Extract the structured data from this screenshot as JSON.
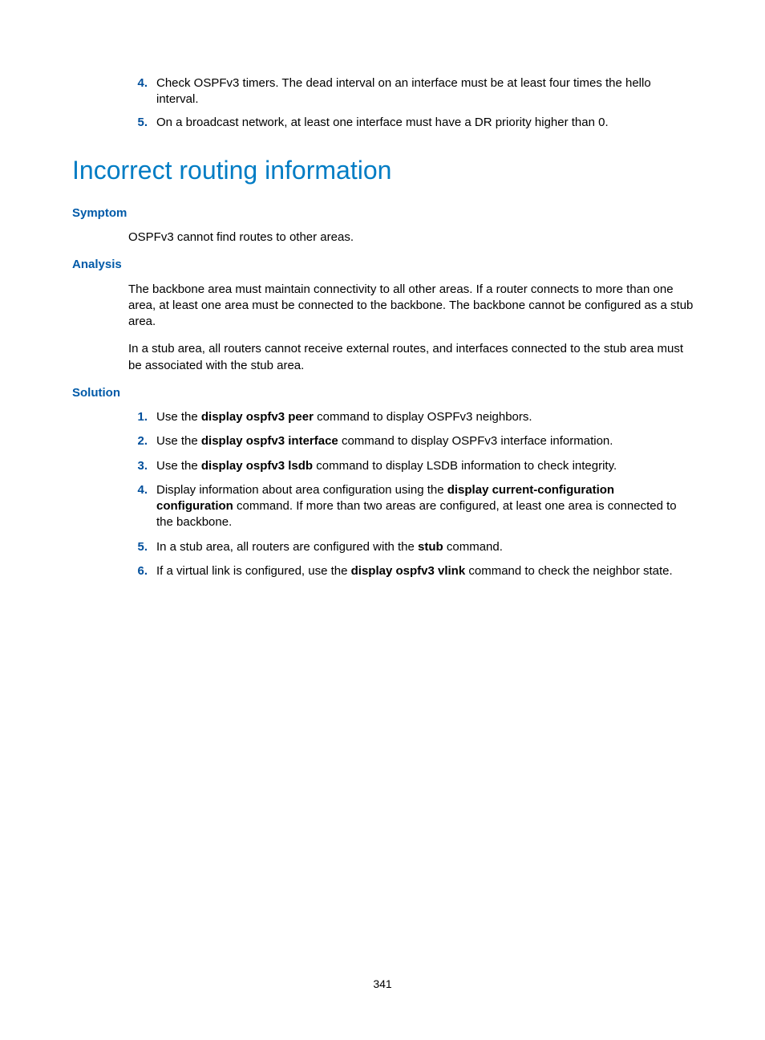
{
  "topList": {
    "item4": {
      "num": "4.",
      "text": "Check OSPFv3 timers. The dead interval on an interface must be at least four times the hello interval."
    },
    "item5": {
      "num": "5.",
      "text": "On a broadcast network, at least one interface must have a DR priority higher than 0."
    }
  },
  "sectionTitle": "Incorrect routing information",
  "symptom": {
    "heading": "Symptom",
    "text": "OSPFv3 cannot find routes to other areas."
  },
  "analysis": {
    "heading": "Analysis",
    "para1": "The backbone area must maintain connectivity to all other areas. If a router connects to more than one area, at least one area must be connected to the backbone. The backbone cannot be configured as a stub area.",
    "para2": "In a stub area, all routers cannot receive external routes, and interfaces connected to the stub area must be associated with the stub area."
  },
  "solution": {
    "heading": "Solution",
    "items": {
      "i1": {
        "num": "1.",
        "pre": "Use the ",
        "bold": "display ospfv3 peer",
        "post": " command to display OSPFv3 neighbors."
      },
      "i2": {
        "num": "2.",
        "pre": "Use the ",
        "bold": "display ospfv3 interface",
        "post": " command to display OSPFv3 interface information."
      },
      "i3": {
        "num": "3.",
        "pre": "Use the ",
        "bold": "display ospfv3 lsdb",
        "post": " command to display LSDB information to check integrity."
      },
      "i4": {
        "num": "4.",
        "pre": "Display information about area configuration using the ",
        "bold": "display current-configuration configuration",
        "post": " command. If more than two areas are configured, at least one area is connected to the backbone."
      },
      "i5": {
        "num": "5.",
        "pre": "In a stub area, all routers are configured with the ",
        "bold": "stub",
        "post": " command."
      },
      "i6": {
        "num": "6.",
        "pre": "If a virtual link is configured, use the ",
        "bold": "display ospfv3 vlink",
        "post": " command to check the neighbor state."
      }
    }
  },
  "pageNumber": "341"
}
